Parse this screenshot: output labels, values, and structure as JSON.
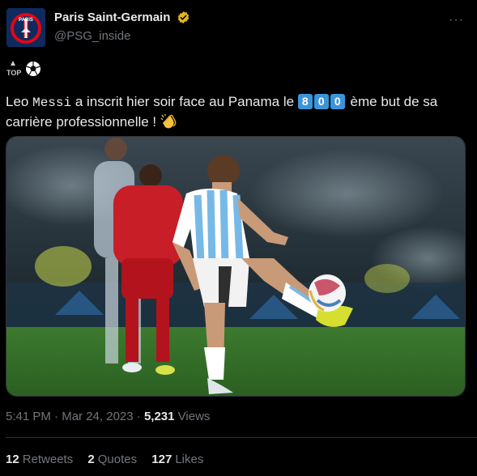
{
  "account": {
    "display_name": "Paris Saint-Germain",
    "handle": "@PSG_inside",
    "avatar_text": "PARIS",
    "avatar_initials": "PSG",
    "verified_icon": "gold-checkmark-badge",
    "avatar_color": "#0e2a5e"
  },
  "header": {
    "more_label": "···"
  },
  "badge": {
    "label": "TOP",
    "icon": "soccer-ball-icon"
  },
  "tweet": {
    "text_part1": "Leo ",
    "text_mono": "Messi",
    "text_part2": " a inscrit hier soir face au Panama le ",
    "digits": [
      "8",
      "0",
      "0"
    ],
    "text_part3": " ème but de sa carrière professionnelle ! ",
    "emoji": "clapping-hands-icon",
    "digit_color": "#3b94d9"
  },
  "meta": {
    "time": "5:41 PM",
    "separator": " · ",
    "date": "Mar 24, 2023",
    "views_count": "5,231",
    "views_label": "Views"
  },
  "stats": {
    "retweets_count": "12",
    "retweets_label": "Retweets",
    "quotes_count": "2",
    "quotes_label": "Quotes",
    "likes_count": "127",
    "likes_label": "Likes"
  },
  "colors": {
    "background": "#000000",
    "text": "#e7e9ea",
    "muted": "#71767b",
    "divider": "#2f3336"
  }
}
